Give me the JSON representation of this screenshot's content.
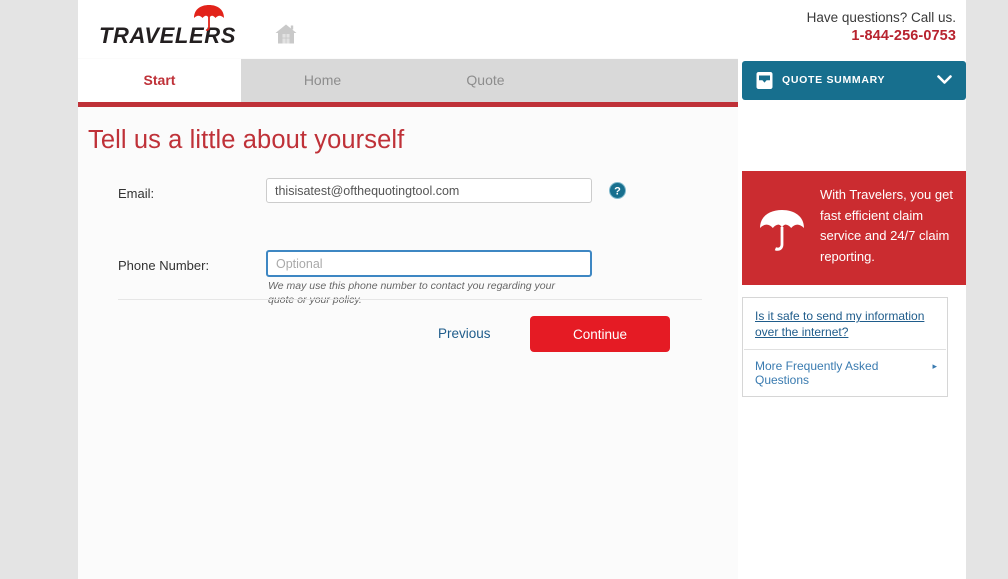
{
  "header": {
    "logo_text": "TRAVELERS",
    "umbrella_icon": "umbrella-icon",
    "house_icon": "house-icon",
    "contact_question": "Have questions? Call us.",
    "contact_phone": "1-844-256-0753"
  },
  "tabs": [
    {
      "label": "Start",
      "active": true
    },
    {
      "label": "Home",
      "active": false
    },
    {
      "label": "Quote",
      "active": false
    }
  ],
  "quote_summary": {
    "label": "QUOTE SUMMARY",
    "icon": "inbox-tray-icon",
    "chevron": "chevron-down-icon"
  },
  "main": {
    "page_title": "Tell us a little about yourself",
    "fields": [
      {
        "label": "Email:",
        "value": "thisisatest@ofthequotingtool.com",
        "placeholder": "",
        "focused": false,
        "help_icon": "help-question-icon"
      },
      {
        "label": "Phone Number:",
        "value": "",
        "placeholder": "Optional",
        "focused": true,
        "hint": "We may use this phone number to contact you regarding your quote or your policy."
      }
    ],
    "buttons": {
      "previous": "Previous",
      "continue": "Continue"
    }
  },
  "sidebar": {
    "promo": {
      "text": "With Travelers, you get fast efficient claim service and 24/7 claim reporting.",
      "icon": "umbrella-icon"
    },
    "faq": {
      "question_link": "Is it safe to send my information over the internet?",
      "more_link": "More Frequently Asked Questions",
      "more_caret": "▸"
    }
  },
  "colors": {
    "brand_red": "#bf3138",
    "button_red": "#e51b24",
    "promo_red": "#cb2c30",
    "teal": "#176f8e",
    "link_blue": "#1f5c8b",
    "focus_blue": "#3e87c3",
    "tabbar_gray": "#d9d9d9",
    "page_gray": "#e4e4e4"
  }
}
